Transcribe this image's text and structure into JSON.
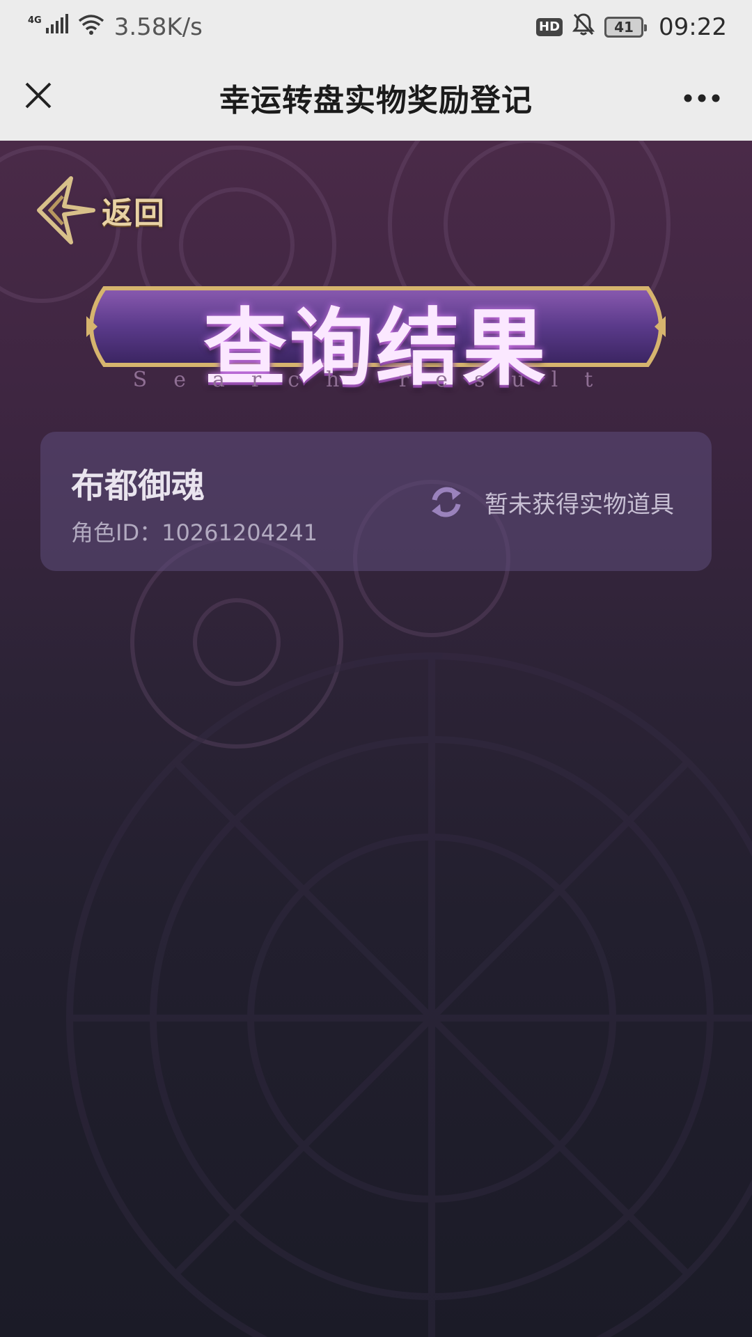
{
  "status_bar": {
    "network": "4G",
    "speed": "3.58K/s",
    "hd": "HD",
    "battery": "41",
    "time": "09:22"
  },
  "navbar": {
    "title": "幸运转盘实物奖励登记"
  },
  "page": {
    "back_label": "返回",
    "banner_title": "查询结果",
    "banner_subtitle": "Search result"
  },
  "result_card": {
    "role_name": "布都御魂",
    "role_id": "角色ID：10261204241",
    "status_text": "暂未获得实物道具"
  },
  "colors": {
    "accent_gold": "#e8d2a4",
    "banner_purple": "#7a3a8e",
    "card_bg": "#5c4c7a"
  }
}
